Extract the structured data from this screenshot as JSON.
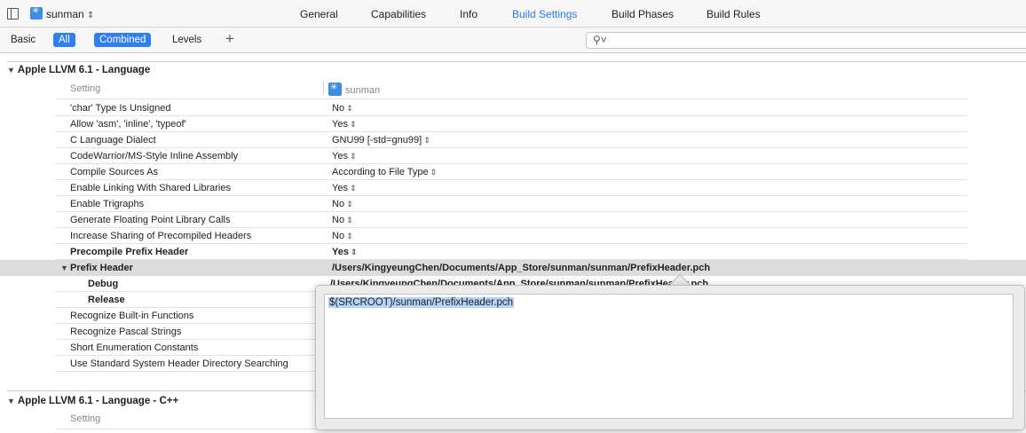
{
  "header": {
    "target_name": "sunman",
    "tabs": [
      {
        "label": "General"
      },
      {
        "label": "Capabilities"
      },
      {
        "label": "Info"
      },
      {
        "label": "Build Settings"
      },
      {
        "label": "Build Phases"
      },
      {
        "label": "Build Rules"
      }
    ],
    "active_tab": "Build Settings",
    "accent_color": "#2a7de1"
  },
  "filters": {
    "basic": "Basic",
    "all": "All",
    "combined": "Combined",
    "levels": "Levels",
    "add": "+",
    "search_value": ""
  },
  "section1": {
    "title": "Apple LLVM 6.1 - Language",
    "col_setting": "Setting",
    "col_target": "sunman",
    "rows": [
      {
        "name": "'char' Type Is Unsigned",
        "value": "No"
      },
      {
        "name": "Allow 'asm', 'inline', 'typeof'",
        "value": "Yes"
      },
      {
        "name": "C Language Dialect",
        "value": "GNU99 [-std=gnu99]"
      },
      {
        "name": "CodeWarrior/MS-Style Inline Assembly",
        "value": "Yes"
      },
      {
        "name": "Compile Sources As",
        "value": "According to File Type"
      },
      {
        "name": "Enable Linking With Shared Libraries",
        "value": "Yes"
      },
      {
        "name": "Enable Trigraphs",
        "value": "No"
      },
      {
        "name": "Generate Floating Point Library Calls",
        "value": "No"
      },
      {
        "name": "Increase Sharing of Precompiled Headers",
        "value": "No"
      },
      {
        "name": "Precompile Prefix Header",
        "value": "Yes"
      }
    ],
    "prefix_header": {
      "name": "Prefix Header",
      "value": "/Users/KingyeungChen/Documents/App_Store/sunman/sunman/PrefixHeader.pch",
      "debug_name": "Debug",
      "debug_value": "/Users/KingyeungChen/Documents/App_Store/sunman/sunman/PrefixHeader.pch",
      "release_name": "Release"
    },
    "rows_after": [
      {
        "name": "Recognize Built-in Functions"
      },
      {
        "name": "Recognize Pascal Strings"
      },
      {
        "name": "Short Enumeration Constants"
      },
      {
        "name": "Use Standard System Header Directory Searching"
      }
    ]
  },
  "section2": {
    "title": "Apple LLVM 6.1 - Language - C++",
    "col_setting": "Setting"
  },
  "popover": {
    "text": "$(SRCROOT)/sunman/PrefixHeader.pch"
  }
}
